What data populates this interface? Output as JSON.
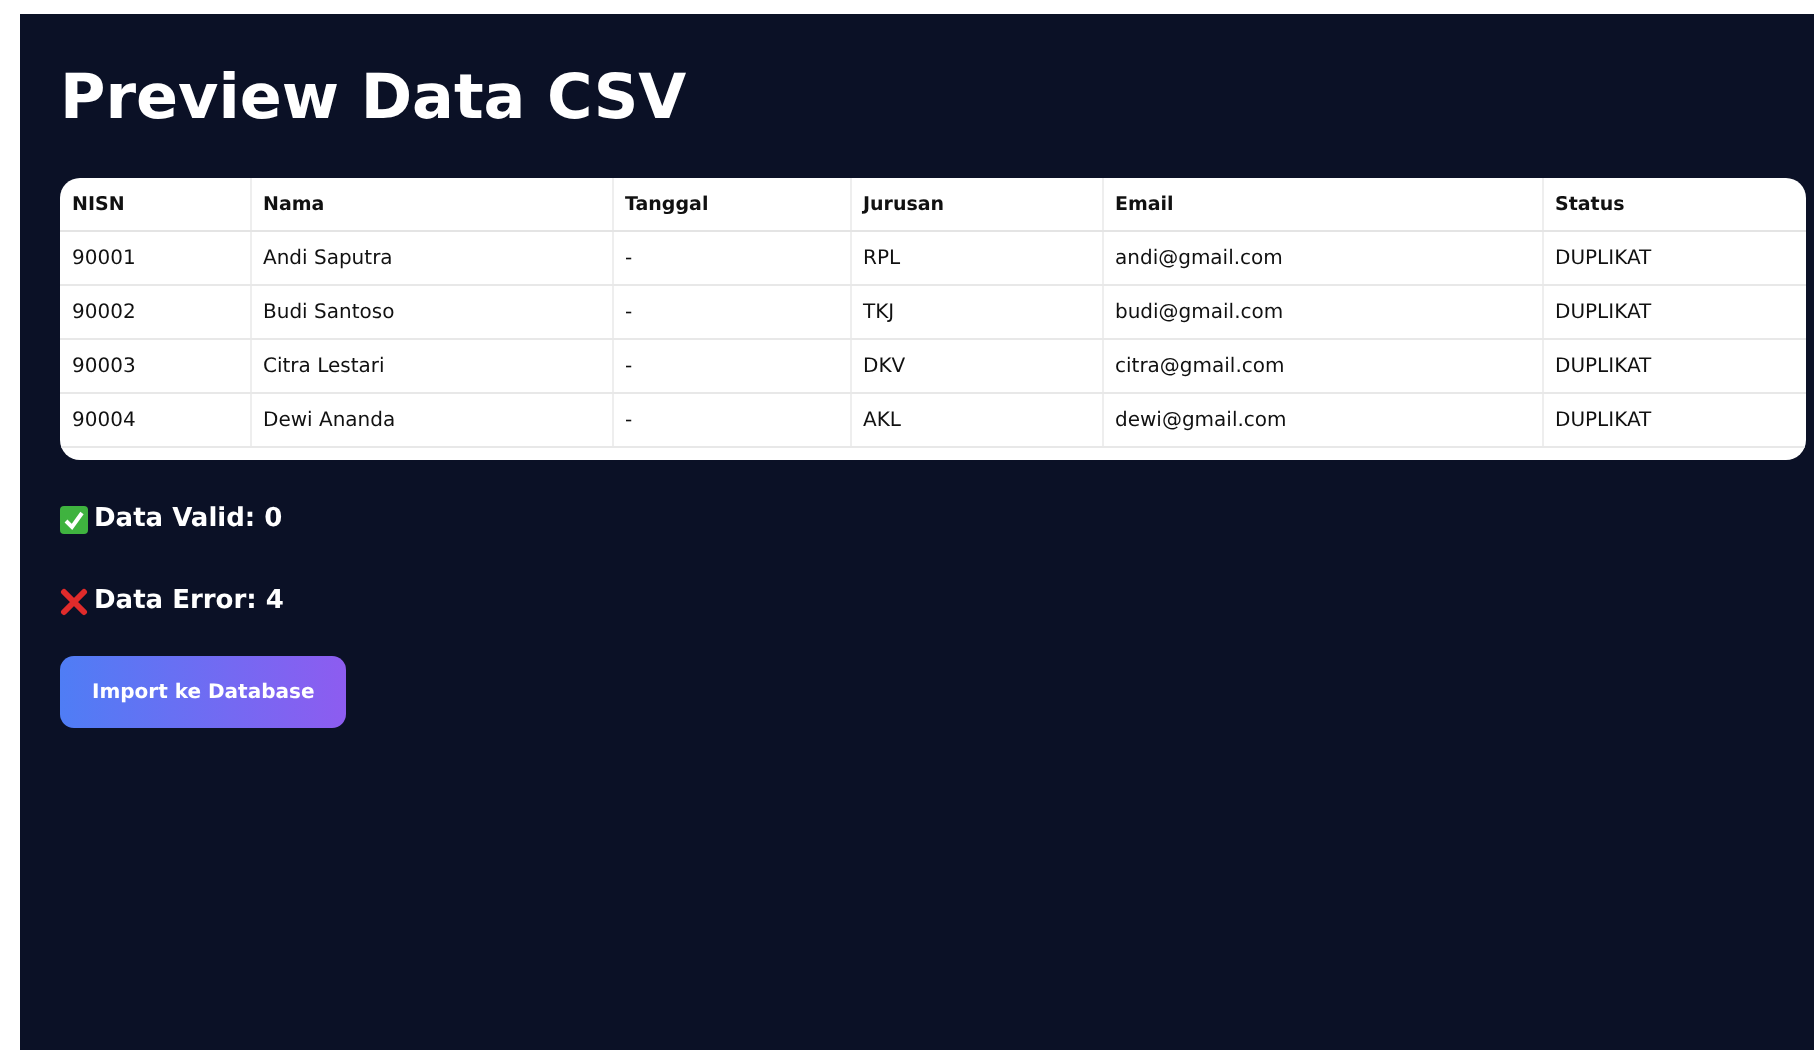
{
  "title": "Preview Data CSV",
  "table": {
    "columns": [
      "NISN",
      "Nama",
      "Tanggal",
      "Jurusan",
      "Email",
      "Status"
    ],
    "rows": [
      [
        "90001",
        "Andi Saputra",
        "-",
        "RPL",
        "andi@gmail.com",
        "DUPLIKAT"
      ],
      [
        "90002",
        "Budi Santoso",
        "-",
        "TKJ",
        "budi@gmail.com",
        "DUPLIKAT"
      ],
      [
        "90003",
        "Citra Lestari",
        "-",
        "DKV",
        "citra@gmail.com",
        "DUPLIKAT"
      ],
      [
        "90004",
        "Dewi Ananda",
        "-",
        "AKL",
        "dewi@gmail.com",
        "DUPLIKAT"
      ]
    ]
  },
  "summary": [
    {
      "kind": "valid",
      "label": "Data Valid: 0"
    },
    {
      "kind": "error",
      "label": "Data Error: 4"
    }
  ],
  "button": "Import ke Database"
}
